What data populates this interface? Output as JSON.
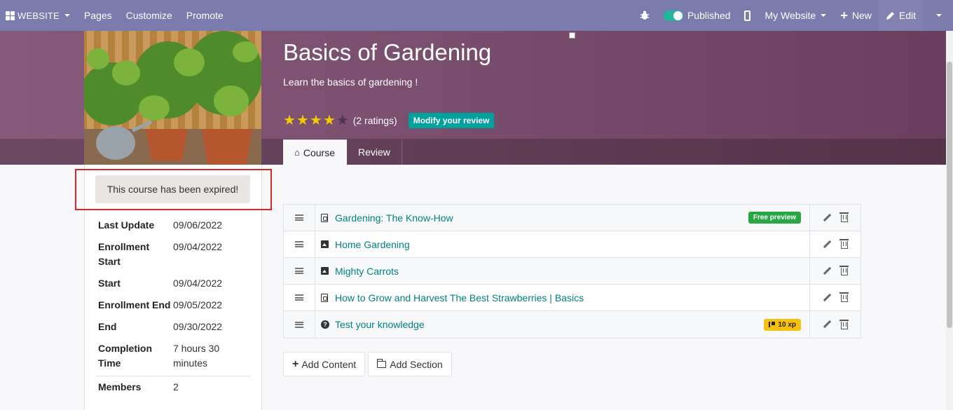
{
  "navbar": {
    "brand": "WEBSITE",
    "menu": [
      "Pages",
      "Customize",
      "Promote"
    ],
    "published_label": "Published",
    "published_on": true,
    "website_selector": "My Website",
    "new_label": "New",
    "edit_label": "Edit"
  },
  "course": {
    "title": "Basics of Gardening",
    "subtitle": "Learn the basics of gardening !",
    "rating_stars": 4,
    "rating_max": 5,
    "ratings_count": "(2 ratings)",
    "modify_review_label": "Modify your review"
  },
  "tabs": [
    {
      "label": "Course",
      "active": true
    },
    {
      "label": "Review",
      "active": false
    }
  ],
  "expired_notice": "This course has been expired!",
  "details": [
    {
      "key": "Last Update",
      "value": "09/06/2022"
    },
    {
      "key": "Enrollment Start",
      "value": "09/04/2022"
    },
    {
      "key": "Start",
      "value": "09/04/2022"
    },
    {
      "key": "Enrollment End",
      "value": "09/05/2022"
    },
    {
      "key": "End",
      "value": "09/30/2022"
    },
    {
      "key": "Completion Time",
      "value": "7 hours 30 minutes"
    },
    {
      "key": "Members",
      "value": "2"
    }
  ],
  "content": [
    {
      "type": "pdf-icon",
      "title": "Gardening: The Know-How",
      "badge": "Free preview"
    },
    {
      "type": "image-icon",
      "title": "Home Gardening",
      "badge": ""
    },
    {
      "type": "image-icon",
      "title": "Mighty Carrots",
      "badge": ""
    },
    {
      "type": "pdf-icon",
      "title": "How to Grow and Harvest The Best Strawberries | Basics",
      "badge": ""
    },
    {
      "type": "question-icon",
      "title": "Test your knowledge",
      "badge": "10 xp"
    }
  ],
  "buttons": {
    "add_content": "Add Content",
    "add_section": "Add Section"
  },
  "colors": {
    "navbar": "#7c7bad",
    "hero": "#875a7b",
    "accent": "#00a09d",
    "link": "#00827e",
    "free_badge": "#28a745",
    "xp_badge": "#f7c10a",
    "highlight_box": "#d9262a"
  }
}
